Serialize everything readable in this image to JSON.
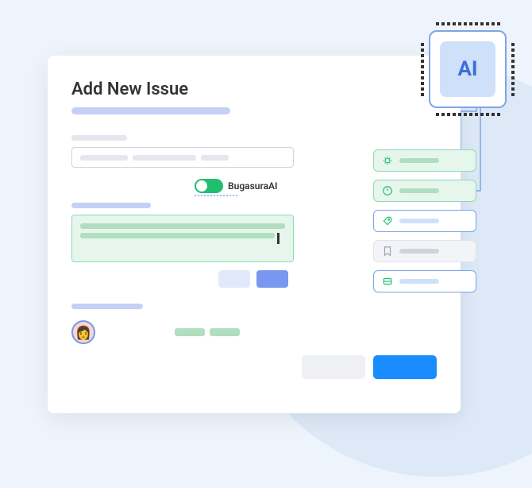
{
  "form": {
    "title": "Add New Issue",
    "ai_toggle_label": "BugasuraAI",
    "ai_toggle_on": true
  },
  "chip": {
    "label": "AI"
  },
  "suggestions": [
    {
      "icon": "bug-icon",
      "style": "green"
    },
    {
      "icon": "alert-icon",
      "style": "green"
    },
    {
      "icon": "tag-icon",
      "style": "blue"
    },
    {
      "icon": "bookmark-icon",
      "style": "grey"
    },
    {
      "icon": "card-icon",
      "style": "blue"
    }
  ]
}
